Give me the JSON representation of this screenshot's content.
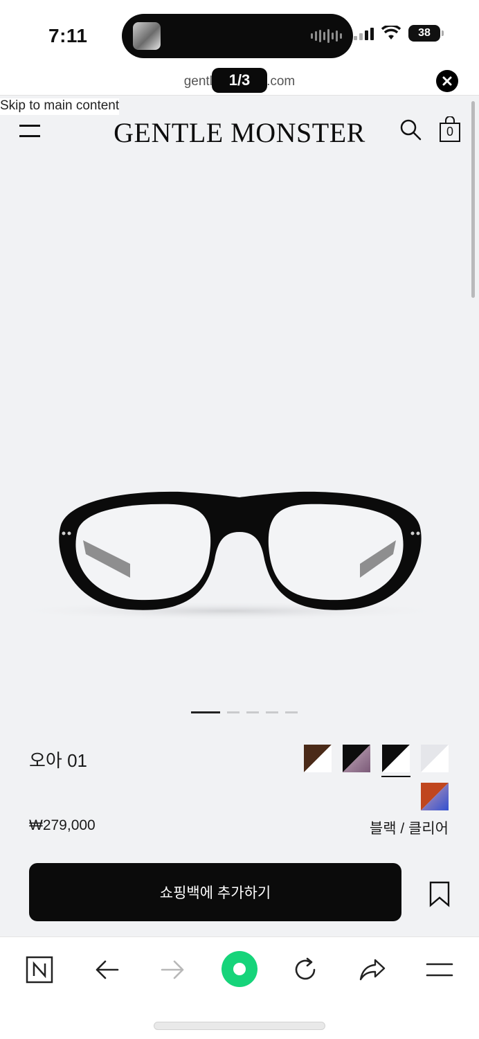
{
  "status_bar": {
    "time": "7:11",
    "battery": "38"
  },
  "browser": {
    "url_text": "gentlemonster.com",
    "tab_indicator": "1/3"
  },
  "page": {
    "skip_link": "Skip to main content",
    "brand": "GENTLE MONSTER",
    "bag_count": "0"
  },
  "product": {
    "name": "오아 01",
    "price": "₩279,000",
    "selected_color": "블랙 / 클리어",
    "image_index": 0,
    "image_total": 5,
    "swatches": [
      {
        "name": "brown-clear",
        "top": "#4a2a18",
        "bottom": "#ffffff"
      },
      {
        "name": "black-purple",
        "top": "#0d0d0d",
        "bottom": "#8a6a86"
      },
      {
        "name": "black-clear",
        "top": "#0d0d0d",
        "bottom": "#ffffff",
        "selected": true
      },
      {
        "name": "clear",
        "top": "#e8e9ec",
        "bottom": "#ffffff"
      },
      {
        "name": "orange-blue",
        "top": "#c0461e",
        "bottom": "#3f5fd0"
      }
    ]
  },
  "cta": {
    "add_to_bag": "쇼핑백에 추가하기"
  },
  "toolbar": {
    "items": [
      "naver-home",
      "back",
      "forward",
      "green-dot",
      "refresh",
      "share",
      "menu"
    ]
  }
}
